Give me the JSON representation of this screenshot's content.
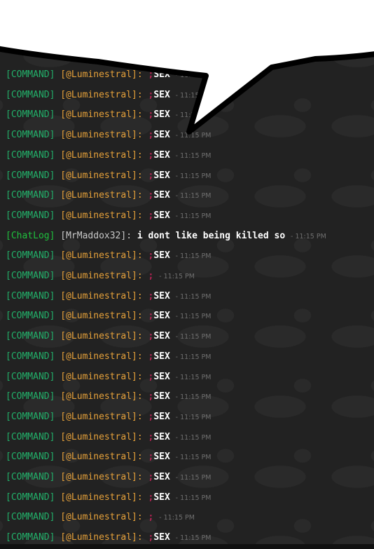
{
  "colors": {
    "background": "#222222",
    "command_tag": "#22b06a",
    "chatlog_tag": "#1fc13e",
    "username": "#e6a13a",
    "player_username": "#c9c9c9",
    "message": "#ffffff",
    "command_prefix": "#b82455",
    "timestamp": "#6f6f6f",
    "speech_bubble": "#ffffff",
    "speech_bubble_outline": "#000000"
  },
  "icons": [
    "speech-bubble-overlay",
    "duck-watermark"
  ],
  "lines": [
    {
      "tag": "[COMMAND]",
      "user": "[@Luminestral]:",
      "prefix": ";",
      "message": "SEX",
      "time": "11:15 PM"
    },
    {
      "tag": "[COMMAND]",
      "user": "[@Luminestral]:",
      "prefix": ";",
      "message": "SEX",
      "time": "11:15 PM"
    },
    {
      "tag": "[COMMAND]",
      "user": "[@Luminestral]:",
      "prefix": ";",
      "message": "SEX",
      "time": "11:15 PM"
    },
    {
      "tag": "[COMMAND]",
      "user": "[@Luminestral]:",
      "prefix": ";",
      "message": "SEX",
      "time": "11:15 PM"
    },
    {
      "tag": "[COMMAND]",
      "user": "[@Luminestral]:",
      "prefix": ";",
      "message": "SEX",
      "time": "11:15 PM"
    },
    {
      "tag": "[COMMAND]",
      "user": "[@Luminestral]:",
      "prefix": ";",
      "message": "SEX",
      "time": "11:15 PM"
    },
    {
      "tag": "[COMMAND]",
      "user": "[@Luminestral]:",
      "prefix": ";",
      "message": "SEX",
      "time": "11:15 PM"
    },
    {
      "tag": "[COMMAND]",
      "user": "[@Luminestral]:",
      "prefix": ";",
      "message": "SEX",
      "time": "11:15 PM"
    },
    {
      "tag": "[ChatLog]",
      "user": "[MrMaddox32]:",
      "prefix": "",
      "message": "i dont like being killed so",
      "time": "11:15 PM"
    },
    {
      "tag": "[COMMAND]",
      "user": "[@Luminestral]:",
      "prefix": ";",
      "message": "SEX",
      "time": "11:15 PM"
    },
    {
      "tag": "[COMMAND]",
      "user": "[@Luminestral]:",
      "prefix": ";",
      "message": "",
      "time": "11:15 PM"
    },
    {
      "tag": "[COMMAND]",
      "user": "[@Luminestral]:",
      "prefix": ";",
      "message": "SEX",
      "time": "11:15 PM"
    },
    {
      "tag": "[COMMAND]",
      "user": "[@Luminestral]:",
      "prefix": ";",
      "message": "SEX",
      "time": "11:15 PM"
    },
    {
      "tag": "[COMMAND]",
      "user": "[@Luminestral]:",
      "prefix": ";",
      "message": "SEX",
      "time": "11:15 PM"
    },
    {
      "tag": "[COMMAND]",
      "user": "[@Luminestral]:",
      "prefix": ";",
      "message": "SEX",
      "time": "11:15 PM"
    },
    {
      "tag": "[COMMAND]",
      "user": "[@Luminestral]:",
      "prefix": ";",
      "message": "SEX",
      "time": "11:15 PM"
    },
    {
      "tag": "[COMMAND]",
      "user": "[@Luminestral]:",
      "prefix": ";",
      "message": "SEX",
      "time": "11:15 PM"
    },
    {
      "tag": "[COMMAND]",
      "user": "[@Luminestral]:",
      "prefix": ";",
      "message": "SEX",
      "time": "11:15 PM"
    },
    {
      "tag": "[COMMAND]",
      "user": "[@Luminestral]:",
      "prefix": ";",
      "message": "SEX",
      "time": "11:15 PM"
    },
    {
      "tag": "[COMMAND]",
      "user": "[@Luminestral]:",
      "prefix": ";",
      "message": "SEX",
      "time": "11:15 PM"
    },
    {
      "tag": "[COMMAND]",
      "user": "[@Luminestral]:",
      "prefix": ";",
      "message": "SEX",
      "time": "11:15 PM"
    },
    {
      "tag": "[COMMAND]",
      "user": "[@Luminestral]:",
      "prefix": ";",
      "message": "SEX",
      "time": "11:15 PM"
    },
    {
      "tag": "[COMMAND]",
      "user": "[@Luminestral]:",
      "prefix": ";",
      "message": "",
      "time": "11:15 PM"
    },
    {
      "tag": "[COMMAND]",
      "user": "[@Luminestral]:",
      "prefix": ";",
      "message": "SEX",
      "time": "11:15 PM"
    }
  ]
}
